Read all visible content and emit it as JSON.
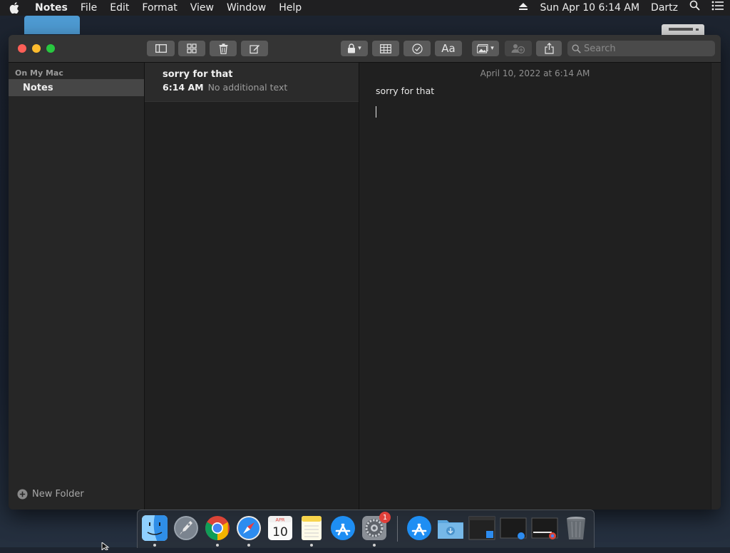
{
  "menubar": {
    "app_name": "Notes",
    "menus": [
      "File",
      "Edit",
      "Format",
      "View",
      "Window",
      "Help"
    ],
    "datetime": "Sun Apr 10  6:14 AM",
    "user": "Dartz"
  },
  "sidebar": {
    "section_label": "On My Mac",
    "folders": [
      {
        "label": "Notes",
        "selected": true
      }
    ],
    "new_folder_label": "New Folder"
  },
  "notes_list": [
    {
      "title": "sorry for that",
      "time": "6:14 AM",
      "preview": "No additional text",
      "selected": true
    }
  ],
  "editor": {
    "date": "April 10, 2022 at 6:14 AM",
    "text": "sorry for that"
  },
  "toolbar": {
    "search_placeholder": "Search",
    "format_label": "Aa"
  },
  "dock": {
    "calendar_month": "APR",
    "calendar_day": "10",
    "system_prefs_badge": "1",
    "apps": [
      "finder-icon",
      "launchpad-icon",
      "chrome-icon",
      "safari-icon",
      "calendar-icon",
      "notes-icon",
      "app-store-icon",
      "system-preferences-icon",
      "app-store-download-icon",
      "downloads-folder-icon",
      "screenshot-icon",
      "screenshot-icon",
      "screenshot-icon",
      "trash-icon"
    ]
  },
  "colors": {
    "close": "#fe5f57",
    "minimize": "#febc2e",
    "zoom": "#28c840",
    "selection": "#464646",
    "badge": "#e0403a"
  }
}
